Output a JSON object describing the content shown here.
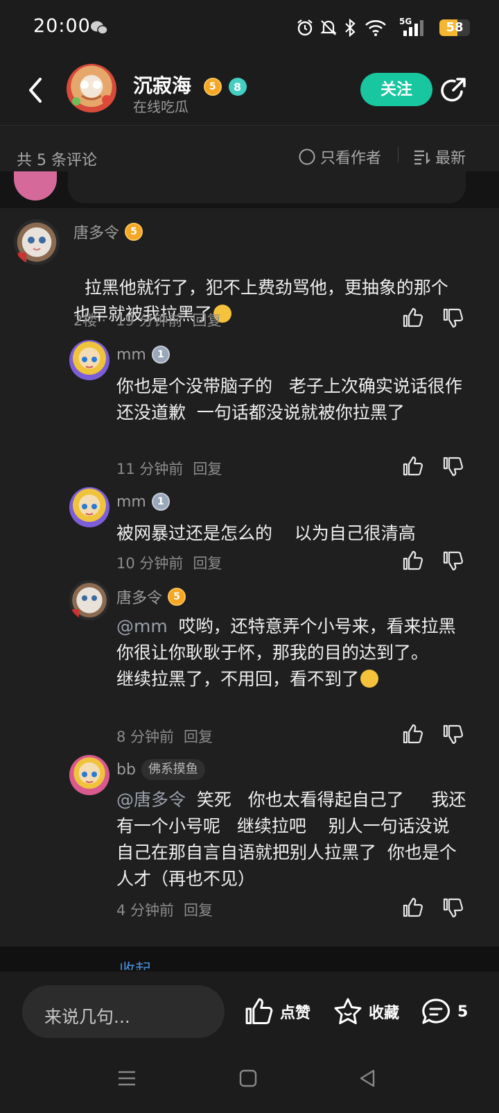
{
  "status_bar": {
    "time": "20:00",
    "network": "5G",
    "battery": "58",
    "battery_level": 0.58,
    "icons": [
      "wechat-icon",
      "alarm-icon",
      "mute-icon",
      "bluetooth-icon",
      "wifi-icon",
      "signal-icon",
      "battery-icon"
    ]
  },
  "header": {
    "username": "沉寂海",
    "status": "在线吃瓜",
    "level_badge": "5",
    "fan_badge": "8",
    "follow_label": "关注"
  },
  "filter_bar": {
    "count_label": "共 5 条评论",
    "author_only_label": "只看作者",
    "sort_label": "最新"
  },
  "main_comment": {
    "author": "唐多令",
    "level_badge": "5",
    "text": "拉黑他就行了，犯不上费劲骂他，更抽象的那个也早就被我拉黑了",
    "floor": "2楼",
    "sep": "·",
    "time": "19 分钟前",
    "reply_label": "回复"
  },
  "replies": [
    {
      "author": "mm",
      "level_badge": "1",
      "text": "你也是个没带脑子的   老子上次确实说话很作   还没道歉  一句话都没说就被你拉黑了",
      "time": "11 分钟前",
      "reply_label": "回复"
    },
    {
      "author": "mm",
      "level_badge": "1",
      "text": "被网暴过还是怎么的    以为自己很清高",
      "time": "10 分钟前",
      "reply_label": "回复"
    },
    {
      "author": "唐多令",
      "level_badge": "5",
      "mention": "@mm",
      "text": "  哎哟，还特意弄个小号来，看来拉黑你很让你耿耿于怀，那我的目的达到了。\n继续拉黑了，不用回，看不到了",
      "time": "8 分钟前",
      "reply_label": "回复"
    },
    {
      "author": "bb",
      "tag": "佛系摸鱼",
      "mention": "@唐多令",
      "text": "  笑死   你也太看得起自己了     我还有一个小号呢   继续拉吧    别人一句话没说   自己在那自言自语就把别人拉黑了  你也是个人才（再也不见）",
      "time": "4 分钟前",
      "reply_label": "回复"
    }
  ],
  "collapse_label": "收起",
  "bottom_bar": {
    "input_placeholder": "来说几句...",
    "like_label": "点赞",
    "favorite_label": "收藏",
    "comment_count": "5"
  },
  "colors": {
    "accent": "#18c6a0",
    "background": "#1b1b1b",
    "link": "#4a8fd9"
  }
}
